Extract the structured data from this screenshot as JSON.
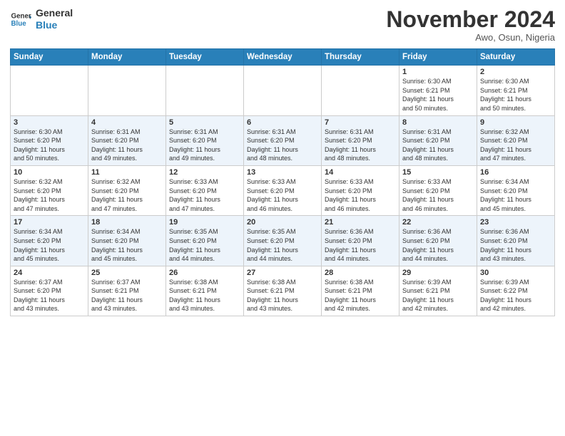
{
  "logo": {
    "line1": "General",
    "line2": "Blue"
  },
  "header": {
    "month": "November 2024",
    "location": "Awo, Osun, Nigeria"
  },
  "weekdays": [
    "Sunday",
    "Monday",
    "Tuesday",
    "Wednesday",
    "Thursday",
    "Friday",
    "Saturday"
  ],
  "weeks": [
    [
      {
        "day": "",
        "info": ""
      },
      {
        "day": "",
        "info": ""
      },
      {
        "day": "",
        "info": ""
      },
      {
        "day": "",
        "info": ""
      },
      {
        "day": "",
        "info": ""
      },
      {
        "day": "1",
        "info": "Sunrise: 6:30 AM\nSunset: 6:21 PM\nDaylight: 11 hours\nand 50 minutes."
      },
      {
        "day": "2",
        "info": "Sunrise: 6:30 AM\nSunset: 6:21 PM\nDaylight: 11 hours\nand 50 minutes."
      }
    ],
    [
      {
        "day": "3",
        "info": "Sunrise: 6:30 AM\nSunset: 6:20 PM\nDaylight: 11 hours\nand 50 minutes."
      },
      {
        "day": "4",
        "info": "Sunrise: 6:31 AM\nSunset: 6:20 PM\nDaylight: 11 hours\nand 49 minutes."
      },
      {
        "day": "5",
        "info": "Sunrise: 6:31 AM\nSunset: 6:20 PM\nDaylight: 11 hours\nand 49 minutes."
      },
      {
        "day": "6",
        "info": "Sunrise: 6:31 AM\nSunset: 6:20 PM\nDaylight: 11 hours\nand 48 minutes."
      },
      {
        "day": "7",
        "info": "Sunrise: 6:31 AM\nSunset: 6:20 PM\nDaylight: 11 hours\nand 48 minutes."
      },
      {
        "day": "8",
        "info": "Sunrise: 6:31 AM\nSunset: 6:20 PM\nDaylight: 11 hours\nand 48 minutes."
      },
      {
        "day": "9",
        "info": "Sunrise: 6:32 AM\nSunset: 6:20 PM\nDaylight: 11 hours\nand 47 minutes."
      }
    ],
    [
      {
        "day": "10",
        "info": "Sunrise: 6:32 AM\nSunset: 6:20 PM\nDaylight: 11 hours\nand 47 minutes."
      },
      {
        "day": "11",
        "info": "Sunrise: 6:32 AM\nSunset: 6:20 PM\nDaylight: 11 hours\nand 47 minutes."
      },
      {
        "day": "12",
        "info": "Sunrise: 6:33 AM\nSunset: 6:20 PM\nDaylight: 11 hours\nand 47 minutes."
      },
      {
        "day": "13",
        "info": "Sunrise: 6:33 AM\nSunset: 6:20 PM\nDaylight: 11 hours\nand 46 minutes."
      },
      {
        "day": "14",
        "info": "Sunrise: 6:33 AM\nSunset: 6:20 PM\nDaylight: 11 hours\nand 46 minutes."
      },
      {
        "day": "15",
        "info": "Sunrise: 6:33 AM\nSunset: 6:20 PM\nDaylight: 11 hours\nand 46 minutes."
      },
      {
        "day": "16",
        "info": "Sunrise: 6:34 AM\nSunset: 6:20 PM\nDaylight: 11 hours\nand 45 minutes."
      }
    ],
    [
      {
        "day": "17",
        "info": "Sunrise: 6:34 AM\nSunset: 6:20 PM\nDaylight: 11 hours\nand 45 minutes."
      },
      {
        "day": "18",
        "info": "Sunrise: 6:34 AM\nSunset: 6:20 PM\nDaylight: 11 hours\nand 45 minutes."
      },
      {
        "day": "19",
        "info": "Sunrise: 6:35 AM\nSunset: 6:20 PM\nDaylight: 11 hours\nand 44 minutes."
      },
      {
        "day": "20",
        "info": "Sunrise: 6:35 AM\nSunset: 6:20 PM\nDaylight: 11 hours\nand 44 minutes."
      },
      {
        "day": "21",
        "info": "Sunrise: 6:36 AM\nSunset: 6:20 PM\nDaylight: 11 hours\nand 44 minutes."
      },
      {
        "day": "22",
        "info": "Sunrise: 6:36 AM\nSunset: 6:20 PM\nDaylight: 11 hours\nand 44 minutes."
      },
      {
        "day": "23",
        "info": "Sunrise: 6:36 AM\nSunset: 6:20 PM\nDaylight: 11 hours\nand 43 minutes."
      }
    ],
    [
      {
        "day": "24",
        "info": "Sunrise: 6:37 AM\nSunset: 6:20 PM\nDaylight: 11 hours\nand 43 minutes."
      },
      {
        "day": "25",
        "info": "Sunrise: 6:37 AM\nSunset: 6:21 PM\nDaylight: 11 hours\nand 43 minutes."
      },
      {
        "day": "26",
        "info": "Sunrise: 6:38 AM\nSunset: 6:21 PM\nDaylight: 11 hours\nand 43 minutes."
      },
      {
        "day": "27",
        "info": "Sunrise: 6:38 AM\nSunset: 6:21 PM\nDaylight: 11 hours\nand 43 minutes."
      },
      {
        "day": "28",
        "info": "Sunrise: 6:38 AM\nSunset: 6:21 PM\nDaylight: 11 hours\nand 42 minutes."
      },
      {
        "day": "29",
        "info": "Sunrise: 6:39 AM\nSunset: 6:21 PM\nDaylight: 11 hours\nand 42 minutes."
      },
      {
        "day": "30",
        "info": "Sunrise: 6:39 AM\nSunset: 6:22 PM\nDaylight: 11 hours\nand 42 minutes."
      }
    ]
  ]
}
